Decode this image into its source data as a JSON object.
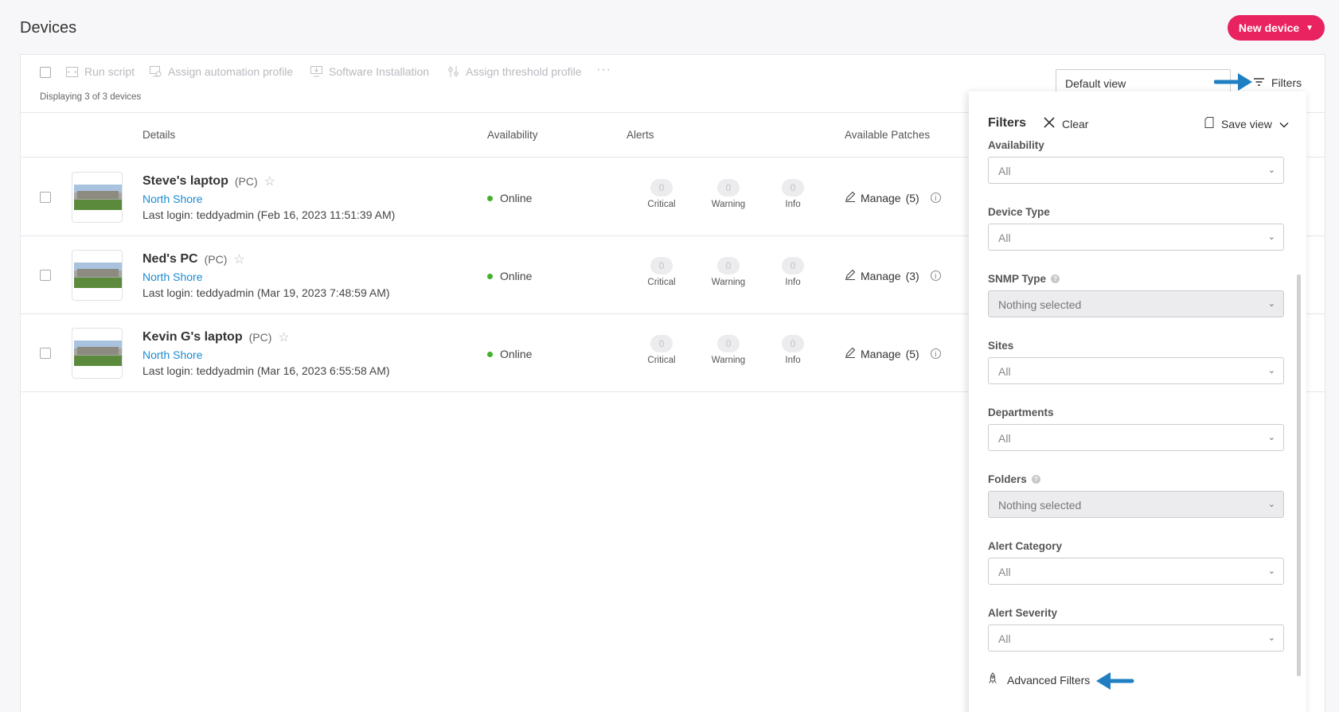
{
  "header": {
    "title": "Devices",
    "new_device_label": "New device"
  },
  "toolbar": {
    "actions": [
      {
        "label": "Run script",
        "icon": "script-icon"
      },
      {
        "label": "Assign automation profile",
        "icon": "automation-icon"
      },
      {
        "label": "Software Installation",
        "icon": "install-icon"
      },
      {
        "label": "Assign threshold profile",
        "icon": "threshold-icon"
      }
    ],
    "more_label": "···",
    "displaying": "Displaying 3 of 3 devices",
    "view_value": "Default view",
    "filters_label": "Filters"
  },
  "table": {
    "columns": {
      "details": "Details",
      "availability": "Availability",
      "alerts": "Alerts",
      "patches": "Available Patches"
    },
    "alert_labels": {
      "critical": "Critical",
      "warning": "Warning",
      "info": "Info"
    },
    "rows": [
      {
        "name": "Steve's laptop",
        "kind": "(PC)",
        "site": "North Shore",
        "login": "Last login: teddyadmin (Feb 16, 2023 11:51:39 AM)",
        "status": "Online",
        "critical": "0",
        "warning": "0",
        "info": "0",
        "manage": "Manage",
        "patch_count": "(5)"
      },
      {
        "name": "Ned's PC",
        "kind": "(PC)",
        "site": "North Shore",
        "login": "Last login: teddyadmin (Mar 19, 2023 7:48:59 AM)",
        "status": "Online",
        "critical": "0",
        "warning": "0",
        "info": "0",
        "manage": "Manage",
        "patch_count": "(3)"
      },
      {
        "name": "Kevin G's laptop",
        "kind": "(PC)",
        "site": "North Shore",
        "login": "Last login: teddyadmin (Mar 16, 2023 6:55:58 AM)",
        "status": "Online",
        "critical": "0",
        "warning": "0",
        "info": "0",
        "manage": "Manage",
        "patch_count": "(5)"
      }
    ]
  },
  "filters": {
    "title": "Filters",
    "clear_label": "Clear",
    "save_view_label": "Save view",
    "fields": [
      {
        "label": "Availability",
        "value": "All",
        "disabled": false,
        "help": false
      },
      {
        "label": "Device Type",
        "value": "All",
        "disabled": false,
        "help": false
      },
      {
        "label": "SNMP Type",
        "value": "Nothing selected",
        "disabled": true,
        "help": true
      },
      {
        "label": "Sites",
        "value": "All",
        "disabled": false,
        "help": false
      },
      {
        "label": "Departments",
        "value": "All",
        "disabled": false,
        "help": false
      },
      {
        "label": "Folders",
        "value": "Nothing selected",
        "disabled": true,
        "help": true
      },
      {
        "label": "Alert Category",
        "value": "All",
        "disabled": false,
        "help": false
      },
      {
        "label": "Alert Severity",
        "value": "All",
        "disabled": false,
        "help": false
      }
    ],
    "advanced_label": "Advanced Filters"
  },
  "colors": {
    "accent": "#e8235f",
    "link": "#1a8bd0",
    "online": "#43b02a",
    "annotation_arrow": "#1f7fc2"
  }
}
